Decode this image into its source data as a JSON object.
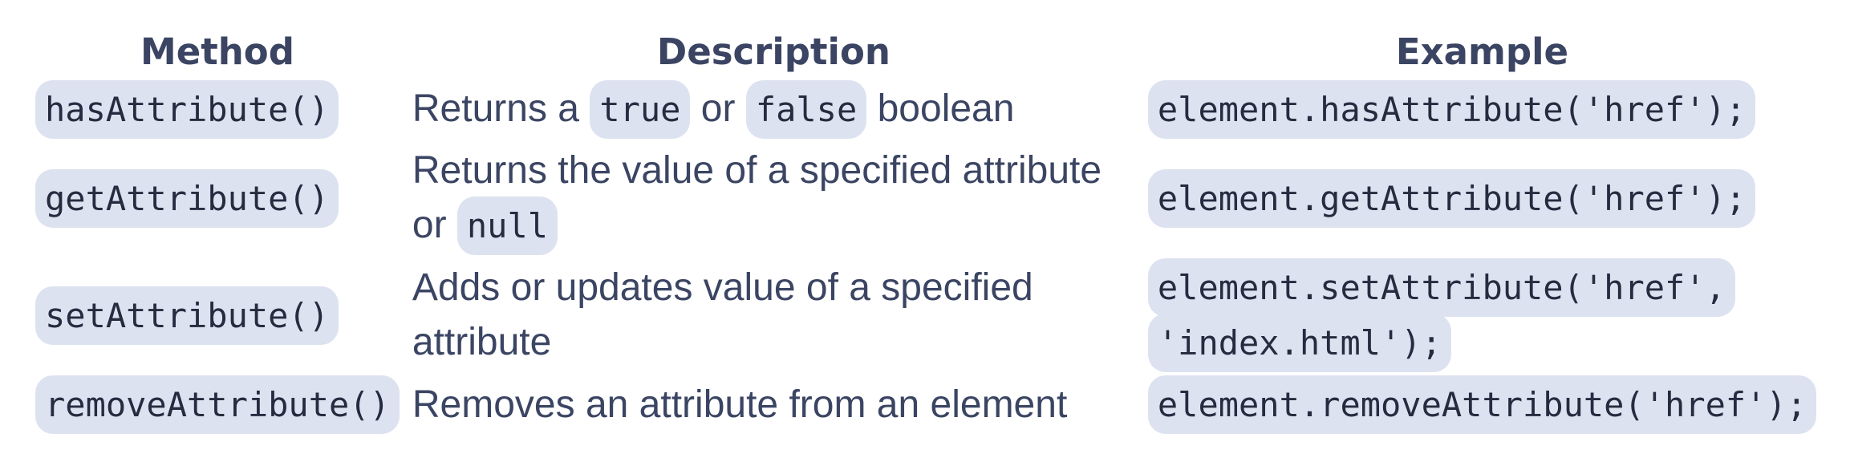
{
  "headers": {
    "method": "Method",
    "description": "Description",
    "example": "Example"
  },
  "rows": [
    {
      "method": "hasAttribute()",
      "desc_text_1": "Returns a ",
      "desc_code_1": "true",
      "desc_text_2": " or ",
      "desc_code_2": "false",
      "desc_text_3": " boolean",
      "example": "element.hasAttribute('href');"
    },
    {
      "method": "getAttribute()",
      "desc_text_1": "Returns the value of a specified attribute or ",
      "desc_code_1": "null",
      "example": "element.getAttribute('href');"
    },
    {
      "method": "setAttribute()",
      "desc_text_1": "Adds or updates value of a specified attribute",
      "example": "element.setAttribute('href', 'index.html');"
    },
    {
      "method": "removeAttribute()",
      "desc_text_1": "Removes an attribute from an element",
      "example": "element.removeAttribute('href');"
    }
  ],
  "colors": {
    "text": "#3b4563",
    "code_background": "#dde2f0",
    "code_text": "#252c40"
  }
}
